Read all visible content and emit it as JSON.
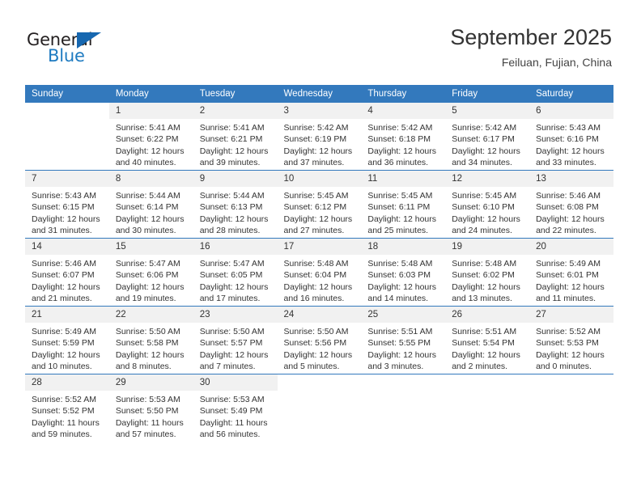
{
  "brand": {
    "name_top": "General",
    "name_bottom": "Blue",
    "triangle_icon": "triangle-icon",
    "colors": {
      "dark": "#231f20",
      "blue": "#1f7bc1",
      "triangle": "#1667b0"
    }
  },
  "header": {
    "title": "September 2025",
    "subtitle": "Feiluan, Fujian, China"
  },
  "theme": {
    "header_bg": "#3379bd",
    "header_text": "#ffffff",
    "daynum_bg": "#f1f1f1",
    "cell_bg": "#ffffff",
    "row_divider": "#3379bd",
    "body_text": "#333333"
  },
  "calendar": {
    "weekday_headers": [
      "Sunday",
      "Monday",
      "Tuesday",
      "Wednesday",
      "Thursday",
      "Friday",
      "Saturday"
    ],
    "weeks": [
      [
        {
          "day": "",
          "blank": true,
          "sunrise": "",
          "sunset": "",
          "daylight_line1": "",
          "daylight_line2": ""
        },
        {
          "day": "1",
          "blank": false,
          "sunrise": "Sunrise: 5:41 AM",
          "sunset": "Sunset: 6:22 PM",
          "daylight_line1": "Daylight: 12 hours",
          "daylight_line2": "and 40 minutes."
        },
        {
          "day": "2",
          "blank": false,
          "sunrise": "Sunrise: 5:41 AM",
          "sunset": "Sunset: 6:21 PM",
          "daylight_line1": "Daylight: 12 hours",
          "daylight_line2": "and 39 minutes."
        },
        {
          "day": "3",
          "blank": false,
          "sunrise": "Sunrise: 5:42 AM",
          "sunset": "Sunset: 6:19 PM",
          "daylight_line1": "Daylight: 12 hours",
          "daylight_line2": "and 37 minutes."
        },
        {
          "day": "4",
          "blank": false,
          "sunrise": "Sunrise: 5:42 AM",
          "sunset": "Sunset: 6:18 PM",
          "daylight_line1": "Daylight: 12 hours",
          "daylight_line2": "and 36 minutes."
        },
        {
          "day": "5",
          "blank": false,
          "sunrise": "Sunrise: 5:42 AM",
          "sunset": "Sunset: 6:17 PM",
          "daylight_line1": "Daylight: 12 hours",
          "daylight_line2": "and 34 minutes."
        },
        {
          "day": "6",
          "blank": false,
          "sunrise": "Sunrise: 5:43 AM",
          "sunset": "Sunset: 6:16 PM",
          "daylight_line1": "Daylight: 12 hours",
          "daylight_line2": "and 33 minutes."
        }
      ],
      [
        {
          "day": "7",
          "blank": false,
          "sunrise": "Sunrise: 5:43 AM",
          "sunset": "Sunset: 6:15 PM",
          "daylight_line1": "Daylight: 12 hours",
          "daylight_line2": "and 31 minutes."
        },
        {
          "day": "8",
          "blank": false,
          "sunrise": "Sunrise: 5:44 AM",
          "sunset": "Sunset: 6:14 PM",
          "daylight_line1": "Daylight: 12 hours",
          "daylight_line2": "and 30 minutes."
        },
        {
          "day": "9",
          "blank": false,
          "sunrise": "Sunrise: 5:44 AM",
          "sunset": "Sunset: 6:13 PM",
          "daylight_line1": "Daylight: 12 hours",
          "daylight_line2": "and 28 minutes."
        },
        {
          "day": "10",
          "blank": false,
          "sunrise": "Sunrise: 5:45 AM",
          "sunset": "Sunset: 6:12 PM",
          "daylight_line1": "Daylight: 12 hours",
          "daylight_line2": "and 27 minutes."
        },
        {
          "day": "11",
          "blank": false,
          "sunrise": "Sunrise: 5:45 AM",
          "sunset": "Sunset: 6:11 PM",
          "daylight_line1": "Daylight: 12 hours",
          "daylight_line2": "and 25 minutes."
        },
        {
          "day": "12",
          "blank": false,
          "sunrise": "Sunrise: 5:45 AM",
          "sunset": "Sunset: 6:10 PM",
          "daylight_line1": "Daylight: 12 hours",
          "daylight_line2": "and 24 minutes."
        },
        {
          "day": "13",
          "blank": false,
          "sunrise": "Sunrise: 5:46 AM",
          "sunset": "Sunset: 6:08 PM",
          "daylight_line1": "Daylight: 12 hours",
          "daylight_line2": "and 22 minutes."
        }
      ],
      [
        {
          "day": "14",
          "blank": false,
          "sunrise": "Sunrise: 5:46 AM",
          "sunset": "Sunset: 6:07 PM",
          "daylight_line1": "Daylight: 12 hours",
          "daylight_line2": "and 21 minutes."
        },
        {
          "day": "15",
          "blank": false,
          "sunrise": "Sunrise: 5:47 AM",
          "sunset": "Sunset: 6:06 PM",
          "daylight_line1": "Daylight: 12 hours",
          "daylight_line2": "and 19 minutes."
        },
        {
          "day": "16",
          "blank": false,
          "sunrise": "Sunrise: 5:47 AM",
          "sunset": "Sunset: 6:05 PM",
          "daylight_line1": "Daylight: 12 hours",
          "daylight_line2": "and 17 minutes."
        },
        {
          "day": "17",
          "blank": false,
          "sunrise": "Sunrise: 5:48 AM",
          "sunset": "Sunset: 6:04 PM",
          "daylight_line1": "Daylight: 12 hours",
          "daylight_line2": "and 16 minutes."
        },
        {
          "day": "18",
          "blank": false,
          "sunrise": "Sunrise: 5:48 AM",
          "sunset": "Sunset: 6:03 PM",
          "daylight_line1": "Daylight: 12 hours",
          "daylight_line2": "and 14 minutes."
        },
        {
          "day": "19",
          "blank": false,
          "sunrise": "Sunrise: 5:48 AM",
          "sunset": "Sunset: 6:02 PM",
          "daylight_line1": "Daylight: 12 hours",
          "daylight_line2": "and 13 minutes."
        },
        {
          "day": "20",
          "blank": false,
          "sunrise": "Sunrise: 5:49 AM",
          "sunset": "Sunset: 6:01 PM",
          "daylight_line1": "Daylight: 12 hours",
          "daylight_line2": "and 11 minutes."
        }
      ],
      [
        {
          "day": "21",
          "blank": false,
          "sunrise": "Sunrise: 5:49 AM",
          "sunset": "Sunset: 5:59 PM",
          "daylight_line1": "Daylight: 12 hours",
          "daylight_line2": "and 10 minutes."
        },
        {
          "day": "22",
          "blank": false,
          "sunrise": "Sunrise: 5:50 AM",
          "sunset": "Sunset: 5:58 PM",
          "daylight_line1": "Daylight: 12 hours",
          "daylight_line2": "and 8 minutes."
        },
        {
          "day": "23",
          "blank": false,
          "sunrise": "Sunrise: 5:50 AM",
          "sunset": "Sunset: 5:57 PM",
          "daylight_line1": "Daylight: 12 hours",
          "daylight_line2": "and 7 minutes."
        },
        {
          "day": "24",
          "blank": false,
          "sunrise": "Sunrise: 5:50 AM",
          "sunset": "Sunset: 5:56 PM",
          "daylight_line1": "Daylight: 12 hours",
          "daylight_line2": "and 5 minutes."
        },
        {
          "day": "25",
          "blank": false,
          "sunrise": "Sunrise: 5:51 AM",
          "sunset": "Sunset: 5:55 PM",
          "daylight_line1": "Daylight: 12 hours",
          "daylight_line2": "and 3 minutes."
        },
        {
          "day": "26",
          "blank": false,
          "sunrise": "Sunrise: 5:51 AM",
          "sunset": "Sunset: 5:54 PM",
          "daylight_line1": "Daylight: 12 hours",
          "daylight_line2": "and 2 minutes."
        },
        {
          "day": "27",
          "blank": false,
          "sunrise": "Sunrise: 5:52 AM",
          "sunset": "Sunset: 5:53 PM",
          "daylight_line1": "Daylight: 12 hours",
          "daylight_line2": "and 0 minutes."
        }
      ],
      [
        {
          "day": "28",
          "blank": false,
          "sunrise": "Sunrise: 5:52 AM",
          "sunset": "Sunset: 5:52 PM",
          "daylight_line1": "Daylight: 11 hours",
          "daylight_line2": "and 59 minutes."
        },
        {
          "day": "29",
          "blank": false,
          "sunrise": "Sunrise: 5:53 AM",
          "sunset": "Sunset: 5:50 PM",
          "daylight_line1": "Daylight: 11 hours",
          "daylight_line2": "and 57 minutes."
        },
        {
          "day": "30",
          "blank": false,
          "sunrise": "Sunrise: 5:53 AM",
          "sunset": "Sunset: 5:49 PM",
          "daylight_line1": "Daylight: 11 hours",
          "daylight_line2": "and 56 minutes."
        },
        {
          "day": "",
          "blank": true,
          "sunrise": "",
          "sunset": "",
          "daylight_line1": "",
          "daylight_line2": ""
        },
        {
          "day": "",
          "blank": true,
          "sunrise": "",
          "sunset": "",
          "daylight_line1": "",
          "daylight_line2": ""
        },
        {
          "day": "",
          "blank": true,
          "sunrise": "",
          "sunset": "",
          "daylight_line1": "",
          "daylight_line2": ""
        },
        {
          "day": "",
          "blank": true,
          "sunrise": "",
          "sunset": "",
          "daylight_line1": "",
          "daylight_line2": ""
        }
      ]
    ]
  }
}
